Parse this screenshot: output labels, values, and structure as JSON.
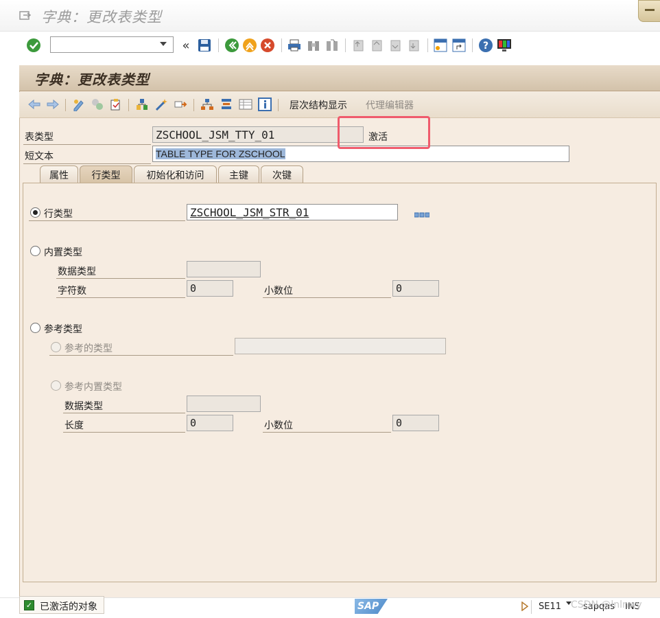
{
  "window": {
    "title": "字典：更改表类型"
  },
  "system_toolbar": {
    "command_field_value": "",
    "icons": [
      "enter-icon",
      "back-arrows-icon",
      "save-icon",
      "back-icon",
      "exit-icon",
      "cancel-icon",
      "print-icon",
      "find-icon",
      "find-next-icon",
      "first-page-icon",
      "previous-page-icon",
      "next-page-icon",
      "last-page-icon",
      "new-session-icon",
      "shortcut-icon",
      "help-icon",
      "layout-icon"
    ]
  },
  "page": {
    "title": "字典：更改表类型"
  },
  "app_toolbar": {
    "hierarchy_label": "层次结构显示",
    "proxy_editor_label": "代理编辑器"
  },
  "header_fields": {
    "table_type_label": "表类型",
    "table_type_value": "ZSCHOOL_JSM_TTY_01",
    "status_text": "激活",
    "short_text_label": "短文本",
    "short_text_value": "TABLE TYPE FOR ZSCHOOL"
  },
  "tabs": [
    {
      "label": "属性",
      "active": false
    },
    {
      "label": "行类型",
      "active": true
    },
    {
      "label": "初始化和访问",
      "active": false
    },
    {
      "label": "主键",
      "active": false
    },
    {
      "label": "次键",
      "active": false
    }
  ],
  "row_type": {
    "option_row_type": "行类型",
    "row_type_value": "ZSCHOOL_JSM_STR_01",
    "option_builtin": "内置类型",
    "data_type_label": "数据类型",
    "data_type_value": "",
    "char_count_label": "字符数",
    "char_count_value": "0",
    "decimals_label": "小数位",
    "decimals_value": "0",
    "option_ref": "参考类型",
    "ref_type_label": "参考的类型",
    "ref_type_value": "",
    "ref_builtin_label": "参考内置类型",
    "ref_data_type_label": "数据类型",
    "ref_data_type_value": "",
    "length_label": "长度",
    "length_value": "0",
    "ref_decimals_label": "小数位",
    "ref_decimals_value": "0"
  },
  "status_bar": {
    "message": "已激活的对象",
    "logo": "SAP",
    "transaction": "SE11",
    "system": "sapqas",
    "mode": "INS",
    "watermark": "CSDN @lnlnwy"
  },
  "colors": {
    "accent_highlight": "#ef5b6c",
    "header_band": "#d3c2aa",
    "panel": "#f6ece1"
  }
}
